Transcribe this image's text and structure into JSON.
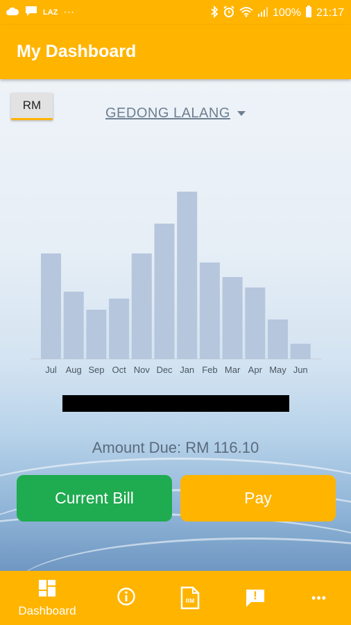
{
  "status_bar": {
    "left_icons": [
      "cloud-icon",
      "chat-bubble-icon",
      "laz-icon",
      "more-icon"
    ],
    "laz_label": "LAZ",
    "dots": "···",
    "right_icons": [
      "bluetooth-icon",
      "alarm-icon",
      "wifi-icon",
      "signal-icon",
      "battery-icon"
    ],
    "battery_percent": "100%",
    "time": "21:17"
  },
  "app_bar": {
    "title": "My Dashboard"
  },
  "currency_toggle": {
    "label": "RM"
  },
  "location": {
    "name": "GEDONG LALANG"
  },
  "chart_data": {
    "type": "bar",
    "categories": [
      "Jul",
      "Aug",
      "Sep",
      "Oct",
      "Nov",
      "Dec",
      "Jan",
      "Feb",
      "Mar",
      "Apr",
      "May",
      "Jun"
    ],
    "values": [
      152,
      97,
      71,
      87,
      152,
      195,
      241,
      139,
      118,
      103,
      57,
      22
    ],
    "bar_color": "#b6c6dd",
    "ylim": [
      0,
      260
    ],
    "title": "",
    "xlabel": "",
    "ylabel": "",
    "grid": false
  },
  "amount_due": {
    "text": "Amount Due: RM 116.10"
  },
  "buttons": {
    "current_bill": "Current Bill",
    "pay": "Pay"
  },
  "bottom_nav": {
    "items": [
      {
        "label": "Dashboard",
        "icon": "dashboard-grid-icon"
      },
      {
        "label": "",
        "icon": "info-icon"
      },
      {
        "label": "",
        "icon": "rm-bill-icon"
      },
      {
        "label": "",
        "icon": "feedback-icon"
      },
      {
        "label": "",
        "icon": "more-icon"
      }
    ],
    "bill_icon_text": "RM",
    "feedback_icon_text": "!",
    "more_icon_text": "•••"
  },
  "colors": {
    "primary": "#ffb400",
    "green": "#1fab50",
    "bar": "#b6c6dd"
  }
}
